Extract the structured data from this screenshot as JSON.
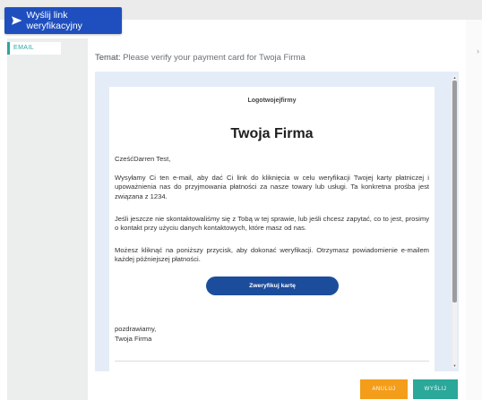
{
  "header": {
    "send_link_label": "Wyślij link weryfikacyjny"
  },
  "sidebar": {
    "tab_email": "EMAIL"
  },
  "subject": {
    "label": "Temat:",
    "value": "Please verify your payment card for Twoja Firma"
  },
  "email": {
    "logo_text": "Logotwojejfirmy",
    "brand": "Twoja Firma",
    "greeting": "CześćDarren Test,",
    "paragraph1": "Wysyłamy Ci ten e-mail, aby dać Ci link do kliknięcia w celu weryfikacji Twojej karty płatniczej i upoważnienia nas do przyjmowania płatności za nasze towary lub usługi. Ta konkretna prośba jest związana z 1234.",
    "paragraph2": "Jeśli jeszcze nie skontaktowaliśmy się z Tobą w tej sprawie, lub jeśli chcesz zapytać, co to jest, prosimy o kontakt przy użyciu danych kontaktowych, które masz od nas.",
    "paragraph3": "Możesz kliknąć na poniższy przycisk, aby dokonać weryfikacji. Otrzymasz powiadomienie e-mailem każdej późniejszej płatności.",
    "verify_button": "Zweryfikuj kartę",
    "sign_off": "pozdrawiamy,",
    "sign_name": "Twoja Firma"
  },
  "footer": {
    "cancel_label": "ANULUJ",
    "send_label": "WYŚLIJ"
  },
  "colors": {
    "primary": "#1f4fbf",
    "accent_teal": "#2aa89a",
    "cancel_orange": "#f49d1a",
    "verify_button": "#1c4d9d"
  },
  "icons": {
    "send_link": "paper-plane-icon"
  }
}
